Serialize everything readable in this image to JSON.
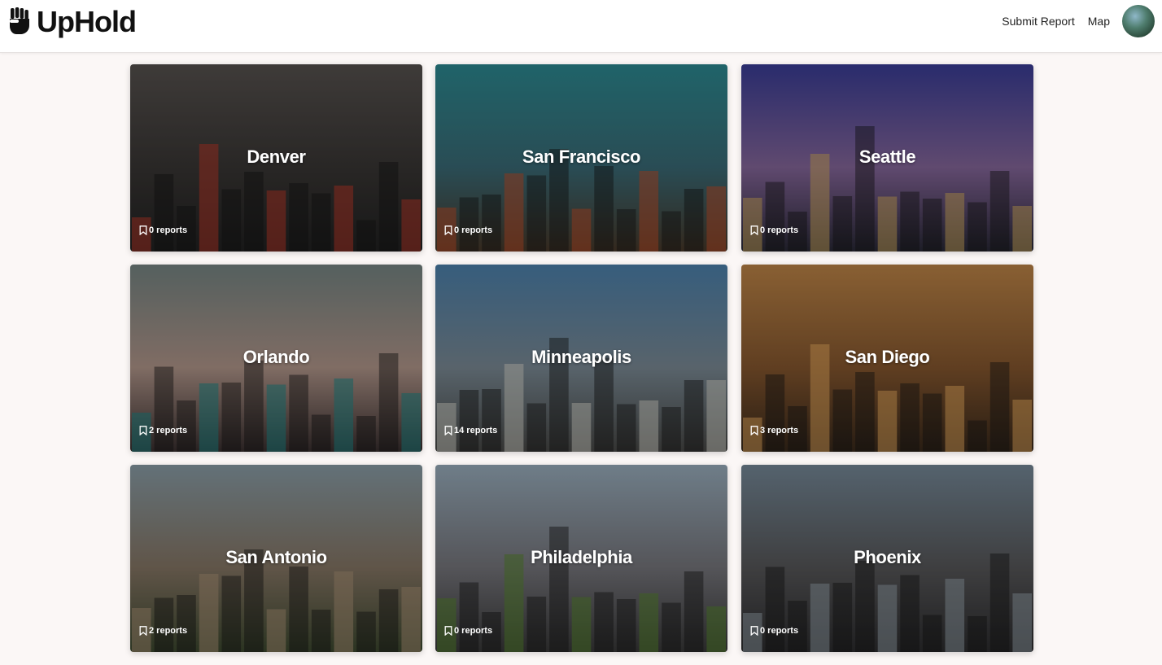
{
  "app": {
    "name": "UpHold"
  },
  "nav": {
    "submit_label": "Submit Report",
    "map_label": "Map"
  },
  "cities": [
    {
      "name": "Denver",
      "reports": "0 reports",
      "bg": [
        "#5a5552",
        "#3b3836",
        "#222"
      ],
      "accent": "#c23a2a"
    },
    {
      "name": "San Francisco",
      "reports": "0 reports",
      "bg": [
        "#2e8f97",
        "#3c6e7a",
        "#4a3a2a"
      ],
      "accent": "#c4502a"
    },
    {
      "name": "Seattle",
      "reports": "0 reports",
      "bg": [
        "#3c3f9c",
        "#8a6aa0",
        "#2a2a38"
      ],
      "accent": "#d9b060"
    },
    {
      "name": "Orlando",
      "reports": "2 reports",
      "bg": [
        "#7a8a88",
        "#b89c90",
        "#3a3030"
      ],
      "accent": "#1d8c8c"
    },
    {
      "name": "Minneapolis",
      "reports": "14 reports",
      "bg": [
        "#4f86b3",
        "#7f8f9a",
        "#4a4a48"
      ],
      "accent": "#d9d9d0"
    },
    {
      "name": "San Diego",
      "reports": "3 reports",
      "bg": [
        "#c58a4a",
        "#8a5a30",
        "#3a2a1c"
      ],
      "accent": "#f0b060"
    },
    {
      "name": "San Antonio",
      "reports": "2 reports",
      "bg": [
        "#8fa3ad",
        "#8a7a68",
        "#3e4a30"
      ],
      "accent": "#b0987a"
    },
    {
      "name": "Philadelphia",
      "reports": "0 reports",
      "bg": [
        "#9fb4c4",
        "#7a7a80",
        "#3a3a3a"
      ],
      "accent": "#5a8a30"
    },
    {
      "name": "Phoenix",
      "reports": "0 reports",
      "bg": [
        "#7a8e9e",
        "#5a5a5c",
        "#2e2e30"
      ],
      "accent": "#9aa8b0"
    }
  ]
}
